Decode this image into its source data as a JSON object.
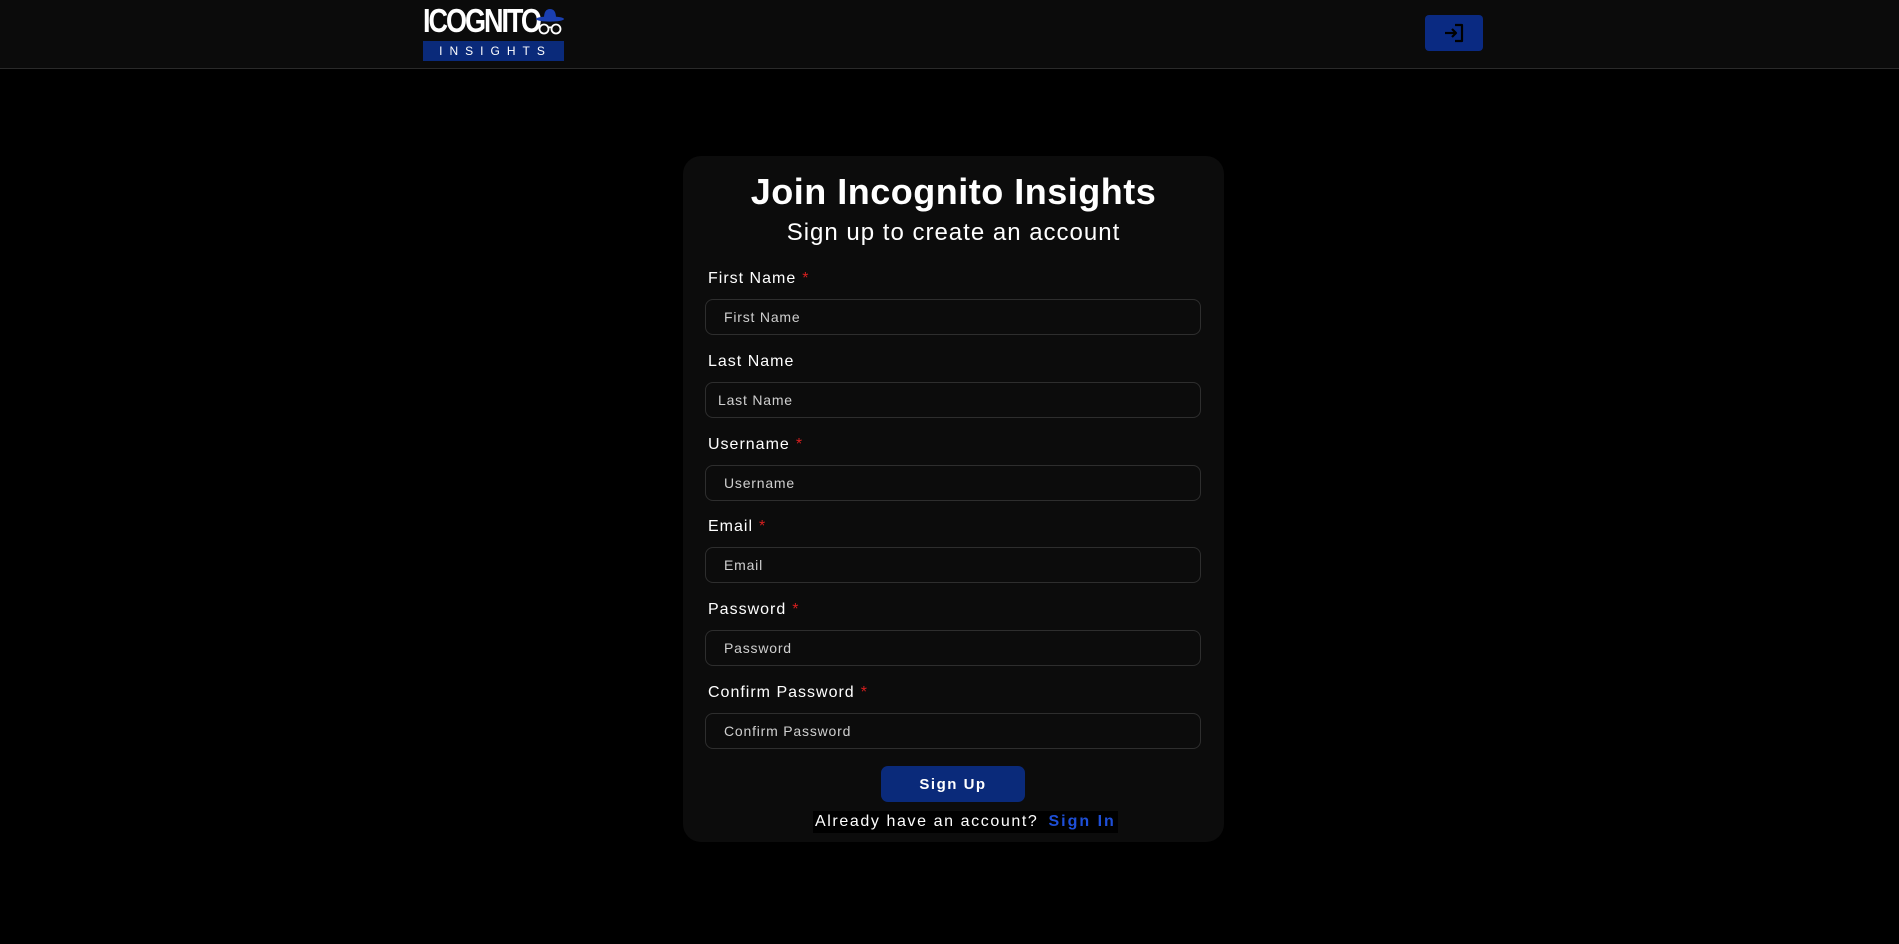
{
  "brand": {
    "logo_word": "ICOGNITO",
    "logo_sub": "INSIGHTS",
    "accent_color": "#0a2a7a",
    "required_color": "#d61f1f",
    "link_color": "#1e4fd8"
  },
  "header": {
    "login_icon": "login-icon"
  },
  "form": {
    "title": "Join Incognito Insights",
    "subtitle": "Sign up to create an account",
    "required_mark": "*",
    "fields": [
      {
        "label": "First Name",
        "placeholder": "First Name",
        "value": "",
        "required": true
      },
      {
        "label": "Last Name",
        "placeholder": "Last Name",
        "value": "",
        "required": false
      },
      {
        "label": "Username",
        "placeholder": "Username",
        "value": "",
        "required": true
      },
      {
        "label": "Email",
        "placeholder": "Email",
        "value": "",
        "required": true
      },
      {
        "label": "Password",
        "placeholder": "Password",
        "value": "",
        "required": true
      },
      {
        "label": "Confirm Password",
        "placeholder": "Confirm Password",
        "value": "",
        "required": true
      }
    ],
    "submit_label": "Sign Up",
    "signin_prompt": "Already have an account?",
    "signin_link": "Sign In"
  }
}
